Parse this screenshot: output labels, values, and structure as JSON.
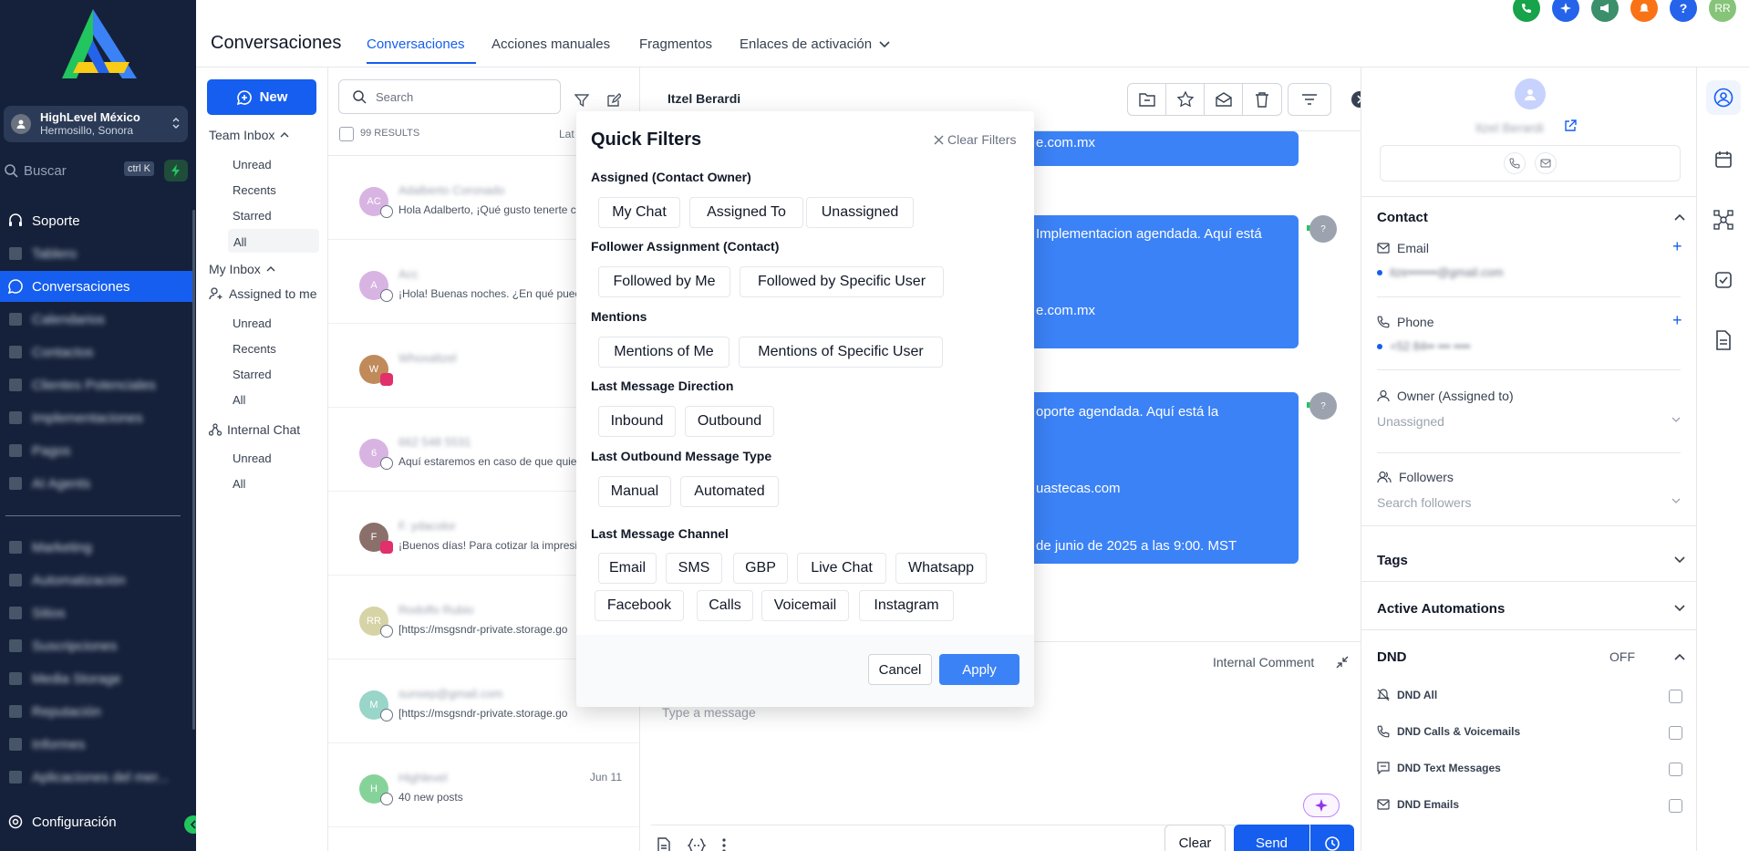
{
  "sidebar": {
    "account": {
      "name": "HighLevel México",
      "location": "Hermosillo, Sonora"
    },
    "search": {
      "placeholder": "Buscar",
      "shortcut": "ctrl K"
    },
    "items": [
      {
        "label": "Soporte",
        "icon": "headset-icon"
      },
      {
        "label": "Tablero",
        "icon": "dashboard-icon"
      },
      {
        "label": "Conversaciones",
        "icon": "chat-icon"
      },
      {
        "label": "Calendarios",
        "icon": "calendar-icon"
      },
      {
        "label": "Contactos",
        "icon": "contacts-icon"
      },
      {
        "label": "Clientes Potenciales",
        "icon": "funnel-icon"
      },
      {
        "label": "Implementaciones",
        "icon": "network-icon"
      },
      {
        "label": "Pagos",
        "icon": "payments-icon"
      },
      {
        "label": "AI Agents",
        "icon": "ai-icon"
      },
      {
        "label": "Marketing",
        "icon": "send-icon"
      },
      {
        "label": "Automatización",
        "icon": "automation-icon"
      },
      {
        "label": "Sitios",
        "icon": "sites-icon"
      },
      {
        "label": "Suscripciones",
        "icon": "membership-icon"
      },
      {
        "label": "Media Storage",
        "icon": "media-icon"
      },
      {
        "label": "Reputación",
        "icon": "star-icon"
      },
      {
        "label": "Informes",
        "icon": "chart-icon"
      },
      {
        "label": "Aplicaciones del mer...",
        "icon": "apps-icon"
      }
    ],
    "settings_label": "Configuración"
  },
  "topbar": {
    "title": "Conversaciones",
    "tabs": [
      {
        "label": "Conversaciones"
      },
      {
        "label": "Acciones manuales"
      },
      {
        "label": "Fragmentos"
      },
      {
        "label": "Enlaces de activación"
      }
    ],
    "avatar_initials": "RR",
    "help_label": "?"
  },
  "inbox": {
    "new_label": "New",
    "team_inbox": {
      "title": "Team Inbox",
      "items": [
        "Unread",
        "Recents",
        "Starred",
        "All"
      ]
    },
    "my_inbox": {
      "title": "My Inbox",
      "assigned": "Assigned to me",
      "items": [
        "Unread",
        "Recents",
        "Starred",
        "All"
      ]
    },
    "internal_chat": {
      "title": "Internal Chat",
      "items": [
        "Unread",
        "All"
      ]
    }
  },
  "conversations": {
    "search_placeholder": "Search",
    "results": "99 RESULTS",
    "sort_label": "Lat",
    "rows": [
      {
        "name": "Adalberto Coronado",
        "preview": "Hola Adalberto, ¡Qué gusto tenerte c",
        "date": "",
        "avatar": "AC",
        "color": "#d8b4e2",
        "channel": "chat"
      },
      {
        "name": "Acc",
        "preview": "¡Hola! Buenas noches. ¿En qué puec",
        "date": "",
        "avatar": "A",
        "color": "#d8b4e2",
        "channel": "chat"
      },
      {
        "name": "Whoxaltzel",
        "preview": "",
        "date": "",
        "avatar": "W",
        "color": "#c08a5a",
        "channel": "instagram"
      },
      {
        "name": "662 548 5531",
        "preview": "Aquí estaremos en caso de que quie",
        "date": "",
        "avatar": "6",
        "color": "#d8b4e2",
        "channel": "chat"
      },
      {
        "name": "F. ydacolor",
        "preview": "¡Buenos días! Para cotizar la impresi",
        "date": "",
        "avatar": "F",
        "color": "#8b6f6a",
        "channel": "instagram"
      },
      {
        "name": "Rodolfo Rubio",
        "preview": "[https://msgsndr-private.storage.go",
        "date": "",
        "avatar": "RR",
        "color": "#d6d3a6",
        "channel": "email"
      },
      {
        "name": "sunsep@gmail.com",
        "preview": "[https://msgsndr-private.storage.go",
        "date": "",
        "avatar": "M",
        "color": "#99d5c9",
        "channel": "email"
      },
      {
        "name": "Highlevel",
        "preview": "40 new posts",
        "date": "Jun 11",
        "avatar": "H",
        "color": "#86d39a",
        "channel": "email"
      }
    ]
  },
  "chat": {
    "contact_name": "Itzel Berardi",
    "messages": [
      {
        "lines": [
          "e.com.mx"
        ]
      },
      {
        "lines": [
          "Implementacion agendada. Aquí está",
          "e.com.mx"
        ]
      },
      {
        "lines": [
          "oporte agendada. Aquí está la",
          "uastecas.com",
          "de junio de 2025 a las 9:00. MST"
        ]
      }
    ],
    "unknown_avatar": "?",
    "internal_comment": "Internal Comment",
    "input_placeholder": "Type a message",
    "clear_label": "Clear",
    "send_label": "Send"
  },
  "quick_filters": {
    "title": "Quick Filters",
    "clear_label": "Clear Filters",
    "sections": [
      {
        "title": "Assigned (Contact Owner)",
        "chips": [
          "My Chat",
          "Assigned To",
          "Unassigned"
        ]
      },
      {
        "title": "Follower Assignment (Contact)",
        "chips": [
          "Followed by Me",
          "Followed by Specific User"
        ]
      },
      {
        "title": "Mentions",
        "chips": [
          "Mentions of Me",
          "Mentions of Specific User"
        ]
      },
      {
        "title": "Last Message Direction",
        "chips": [
          "Inbound",
          "Outbound"
        ]
      },
      {
        "title": "Last Outbound Message Type",
        "chips": [
          "Manual",
          "Automated"
        ]
      },
      {
        "title": "Last Message Channel",
        "chips": [
          "Email",
          "SMS",
          "GBP",
          "Live Chat",
          "Whatsapp",
          "Facebook",
          "Calls",
          "Voicemail",
          "Instagram"
        ]
      }
    ],
    "cancel_label": "Cancel",
    "apply_label": "Apply"
  },
  "contact_panel": {
    "name": "Itzel Berardi",
    "contact_title": "Contact",
    "email_label": "Email",
    "email_value": "itze•••••••@gmail.com",
    "phone_label": "Phone",
    "phone_value": "+52 84•• ••• ••••",
    "owner_label": "Owner (Assigned to)",
    "owner_value": "Unassigned",
    "followers_label": "Followers",
    "followers_placeholder": "Search followers",
    "tags_title": "Tags",
    "automations_title": "Active Automations",
    "dnd_title": "DND",
    "dnd_status": "OFF",
    "dnd_items": [
      "DND All",
      "DND Calls & Voicemails",
      "DND Text Messages",
      "DND Emails"
    ]
  }
}
